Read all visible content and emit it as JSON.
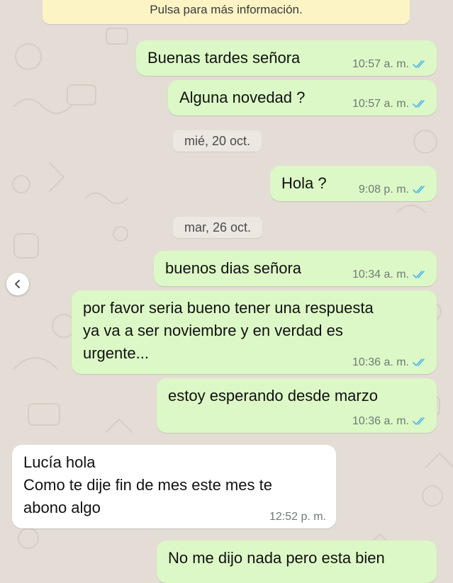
{
  "banner": {
    "text": "Pulsa para más información."
  },
  "messages": [
    {
      "text": "Buenas tardes señora",
      "time": "10:57 a. m."
    },
    {
      "text": "Alguna novedad ?",
      "time": "10:57 a. m."
    },
    {
      "text": "Hola ?",
      "time": "9:08 p. m."
    },
    {
      "text": "buenos dias señora",
      "time": "10:34 a. m."
    },
    {
      "text": "por favor seria bueno tener una respuesta\nya va a ser noviembre y en verdad es\nurgente...",
      "time": "10:36 a. m."
    },
    {
      "text": "estoy esperando desde marzo",
      "time": "10:36 a. m."
    },
    {
      "text": "Lucía hola\nComo te dije fin de mes este mes te\nabono algo",
      "time": "12:52 p. m."
    },
    {
      "text": "No me dijo nada pero esta bien"
    }
  ],
  "date_separators": [
    "mié, 20 oct.",
    "mar, 26 oct."
  ],
  "colors": {
    "outgoing_bubble": "#dcf8c6",
    "incoming_bubble": "#ffffff",
    "read_ticks": "#4fb6ec",
    "banner": "#fdf4c5",
    "chat_background": "#e4ddd6"
  },
  "icons": {
    "read_receipt": "double-check-icon",
    "nav": "chevron-left-icon"
  }
}
